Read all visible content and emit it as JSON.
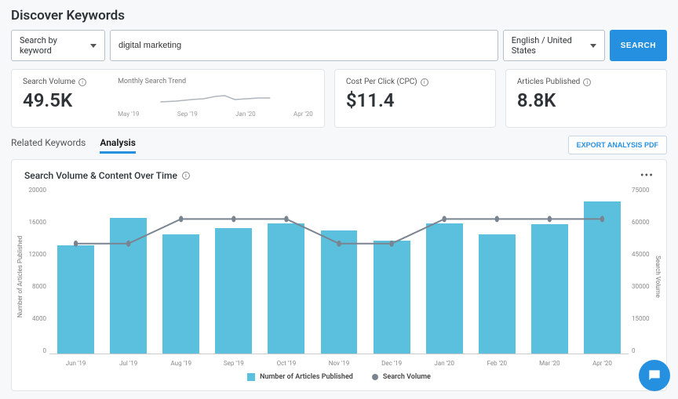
{
  "page_title": "Discover Keywords",
  "search": {
    "type_label": "Search by keyword",
    "query": "digital marketing",
    "locale": "English / United States",
    "button": "SEARCH"
  },
  "cards": {
    "search_volume": {
      "label": "Search Volume",
      "value": "49.5K"
    },
    "trend": {
      "label": "Monthly Search Trend",
      "ticks": [
        "May '19",
        "Sep '19",
        "Jan '20",
        "Apr '20"
      ]
    },
    "cpc": {
      "label": "Cost Per Click (CPC)",
      "value": "$11.4"
    },
    "articles": {
      "label": "Articles Published",
      "value": "8.8K"
    }
  },
  "tabs": {
    "related": "Related Keywords",
    "analysis": "Analysis"
  },
  "export_button": "EXPORT ANALYSIS PDF",
  "chart": {
    "title": "Search Volume & Content Over Time",
    "y_left_label": "Number of Articles Published",
    "y_right_label": "Search Volume",
    "y_left_ticks": [
      "20000",
      "16000",
      "12000",
      "8000",
      "4000",
      "0"
    ],
    "y_right_ticks": [
      "75000",
      "60000",
      "45000",
      "30000",
      "15000",
      "0"
    ],
    "legend_bars": "Number of Articles Published",
    "legend_line": "Search Volume"
  },
  "chart_data": {
    "type": "bar",
    "title": "Search Volume & Content Over Time",
    "categories": [
      "Jun '19",
      "Jul '19",
      "Aug '19",
      "Sep '19",
      "Oct '19",
      "Nov '19",
      "Dec '19",
      "Jan '20",
      "Feb '20",
      "Mar '20",
      "Apr '20"
    ],
    "series": [
      {
        "name": "Number of Articles Published",
        "axis": "left",
        "kind": "bar",
        "values": [
          13000,
          16200,
          14300,
          15000,
          15600,
          14700,
          13500,
          15600,
          14300,
          15500,
          18200
        ]
      },
      {
        "name": "Search Volume",
        "axis": "right",
        "kind": "line",
        "values": [
          49500,
          49500,
          60500,
          60500,
          60500,
          49500,
          49500,
          60500,
          60500,
          60500,
          60500
        ]
      }
    ],
    "y_left": {
      "label": "Number of Articles Published",
      "lim": [
        0,
        20000
      ]
    },
    "y_right": {
      "label": "Search Volume",
      "lim": [
        0,
        75000
      ]
    },
    "xlabel": ""
  },
  "colors": {
    "accent": "#2690e0",
    "bar": "#5bc0de",
    "line": "#7a8490"
  }
}
